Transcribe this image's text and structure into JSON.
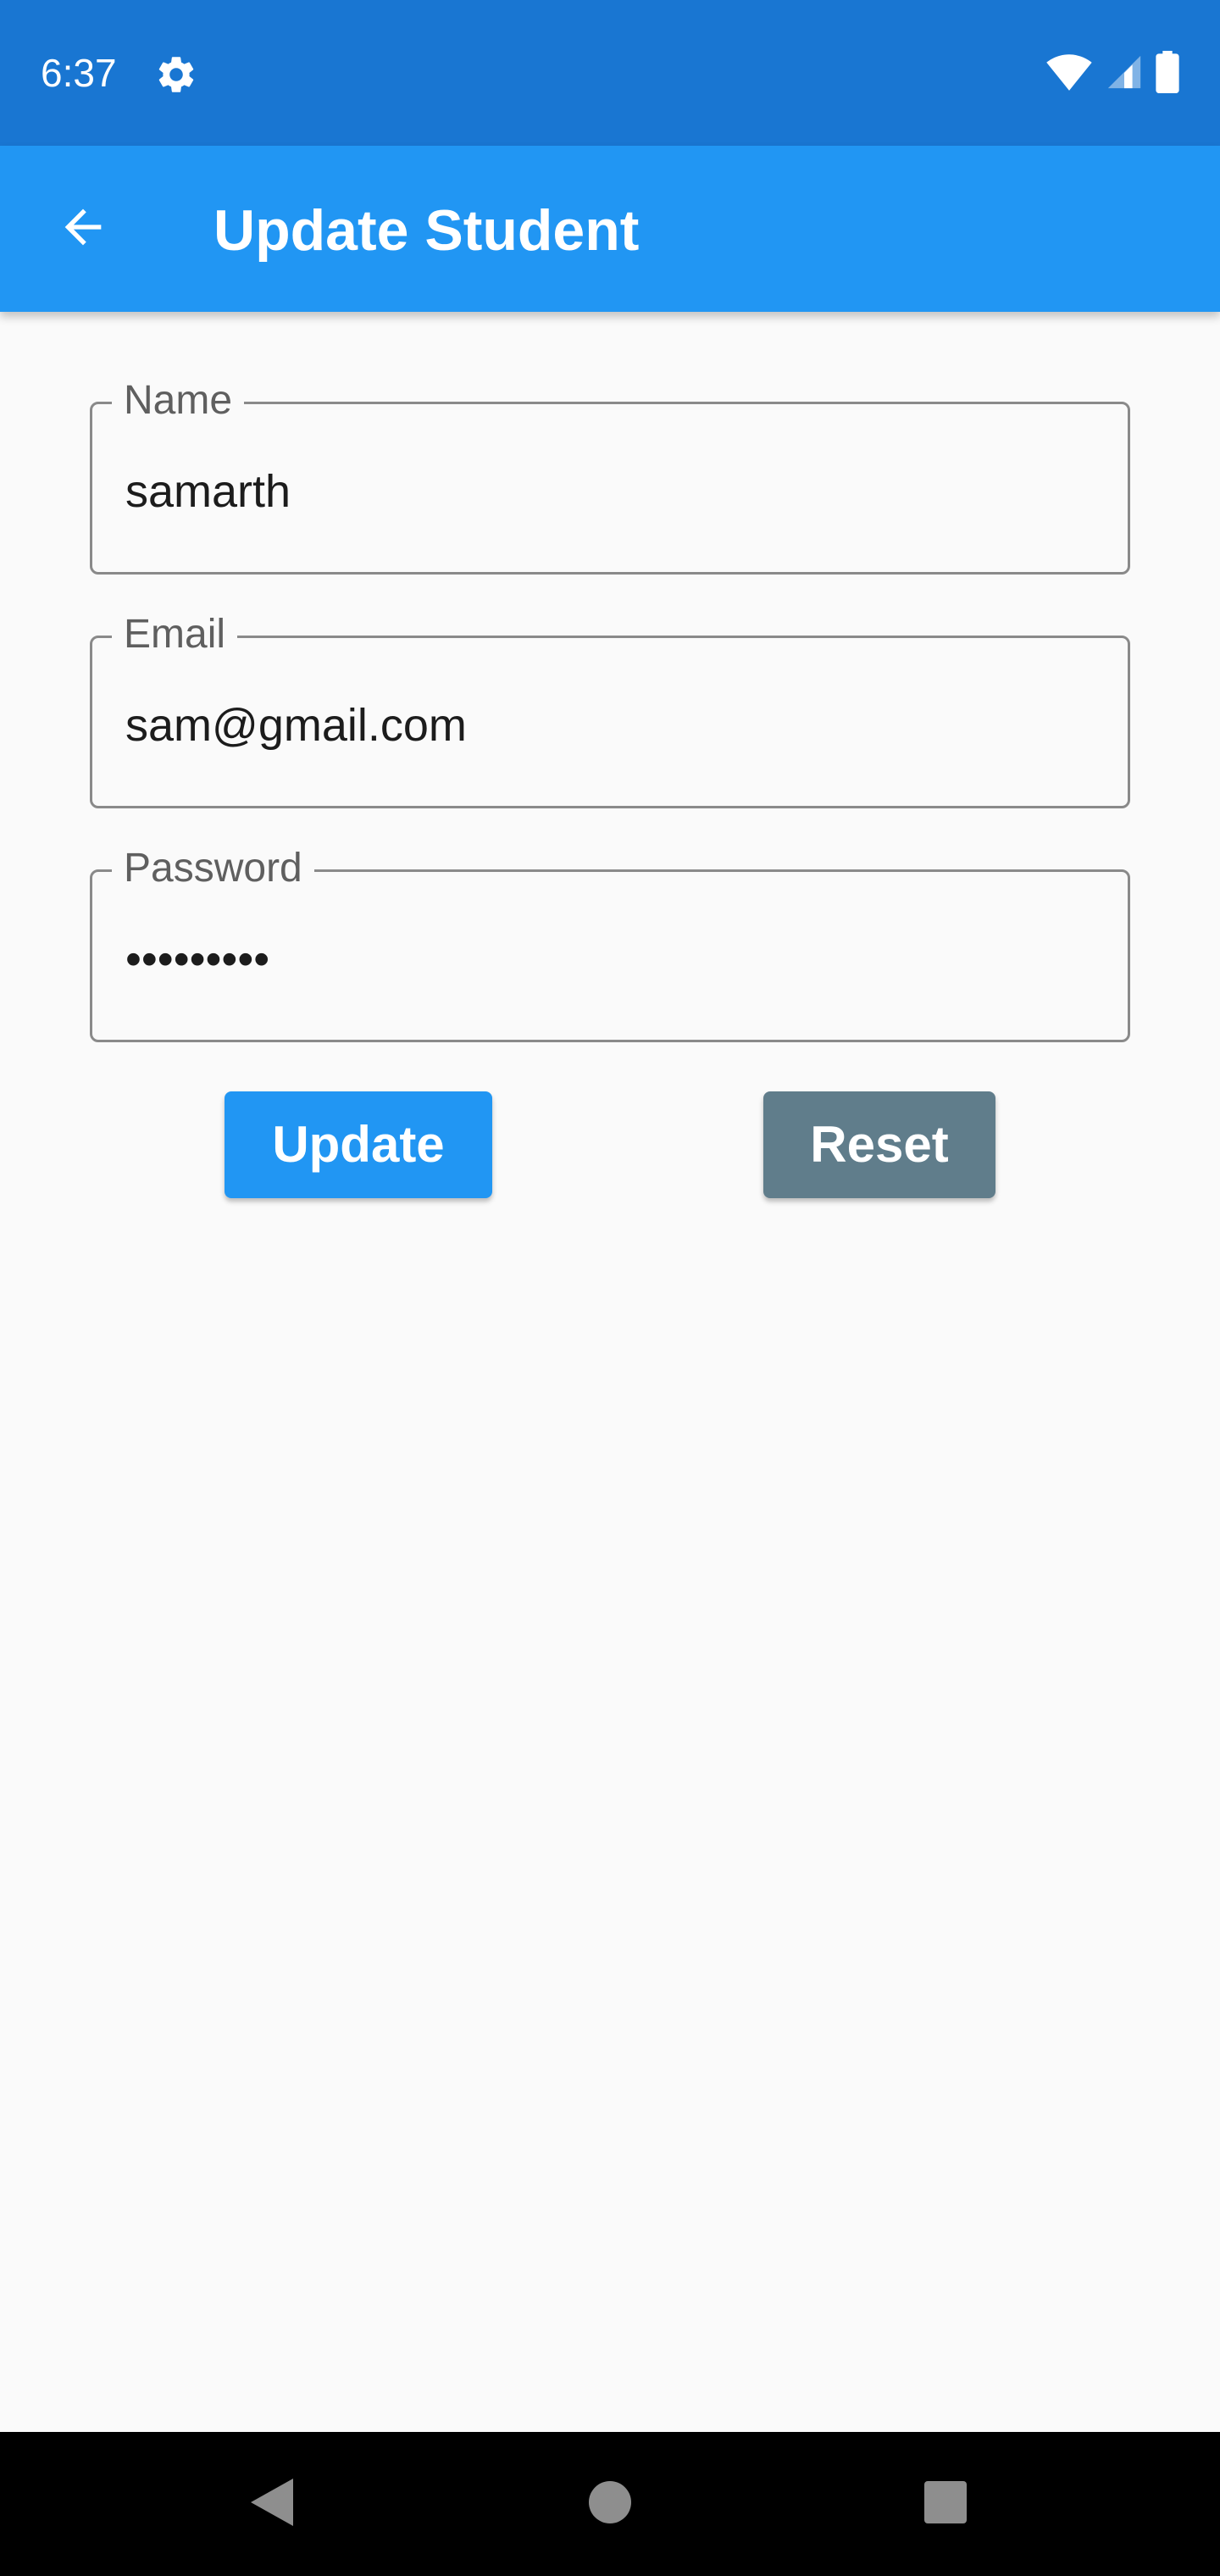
{
  "status_bar": {
    "time": "6:37",
    "settings_icon": "gear-icon",
    "wifi_icon": "wifi-icon",
    "signal_icon": "cellular-signal-icon",
    "battery_icon": "battery-icon",
    "background": "#1976d2"
  },
  "app_bar": {
    "back_icon": "arrow-back-icon",
    "title": "Update Student",
    "background": "#2196f3"
  },
  "form": {
    "name": {
      "label": "Name",
      "value": "samarth"
    },
    "email": {
      "label": "Email",
      "value": "sam@gmail.com"
    },
    "password": {
      "label": "Password",
      "value": "•••••••••"
    }
  },
  "buttons": {
    "update_label": "Update",
    "update_color": "#2196f3",
    "reset_label": "Reset",
    "reset_color": "#607d8b"
  },
  "nav_bar": {
    "back_icon": "nav-back-triangle-icon",
    "home_icon": "nav-home-circle-icon",
    "recents_icon": "nav-recents-square-icon"
  }
}
